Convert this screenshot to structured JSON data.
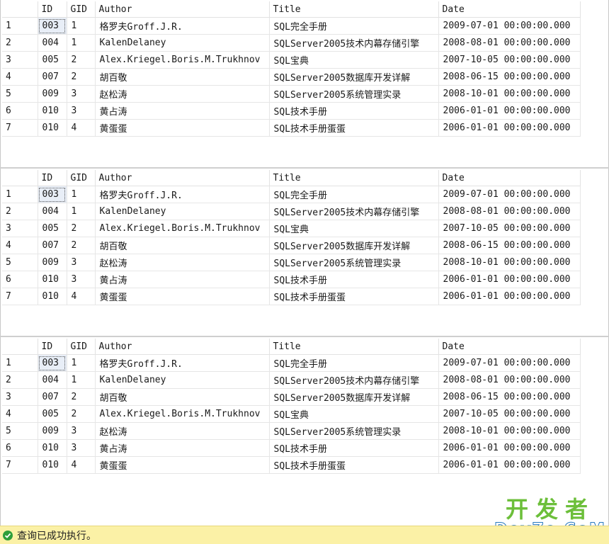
{
  "columns": [
    "",
    "ID",
    "GID",
    "Author",
    "Title",
    "Date"
  ],
  "grids": [
    {
      "rows": [
        [
          "1",
          "003",
          "1",
          "格罗夫Groff.J.R.",
          "SQL完全手册",
          "2009-07-01 00:00:00.000"
        ],
        [
          "2",
          "004",
          "1",
          "KalenDelaney",
          "SQLServer2005技术内幕存储引擎",
          "2008-08-01 00:00:00.000"
        ],
        [
          "3",
          "005",
          "2",
          "Alex.Kriegel.Boris.M.Trukhnov",
          "SQL宝典",
          "2007-10-05 00:00:00.000"
        ],
        [
          "4",
          "007",
          "2",
          "胡百敬",
          "SQLServer2005数据库开发详解",
          "2008-06-15 00:00:00.000"
        ],
        [
          "5",
          "009",
          "3",
          "赵松涛",
          "SQLServer2005系统管理实录",
          "2008-10-01 00:00:00.000"
        ],
        [
          "6",
          "010",
          "3",
          "黄占涛",
          "SQL技术手册",
          "2006-01-01 00:00:00.000"
        ],
        [
          "7",
          "010",
          "4",
          "黄蛋蛋",
          "SQL技术手册蛋蛋",
          "2006-01-01 00:00:00.000"
        ]
      ]
    },
    {
      "rows": [
        [
          "1",
          "003",
          "1",
          "格罗夫Groff.J.R.",
          "SQL完全手册",
          "2009-07-01 00:00:00.000"
        ],
        [
          "2",
          "004",
          "1",
          "KalenDelaney",
          "SQLServer2005技术内幕存储引擎",
          "2008-08-01 00:00:00.000"
        ],
        [
          "3",
          "005",
          "2",
          "Alex.Kriegel.Boris.M.Trukhnov",
          "SQL宝典",
          "2007-10-05 00:00:00.000"
        ],
        [
          "4",
          "007",
          "2",
          "胡百敬",
          "SQLServer2005数据库开发详解",
          "2008-06-15 00:00:00.000"
        ],
        [
          "5",
          "009",
          "3",
          "赵松涛",
          "SQLServer2005系统管理实录",
          "2008-10-01 00:00:00.000"
        ],
        [
          "6",
          "010",
          "3",
          "黄占涛",
          "SQL技术手册",
          "2006-01-01 00:00:00.000"
        ],
        [
          "7",
          "010",
          "4",
          "黄蛋蛋",
          "SQL技术手册蛋蛋",
          "2006-01-01 00:00:00.000"
        ]
      ]
    },
    {
      "rows": [
        [
          "1",
          "003",
          "1",
          "格罗夫Groff.J.R.",
          "SQL完全手册",
          "2009-07-01 00:00:00.000"
        ],
        [
          "2",
          "004",
          "1",
          "KalenDelaney",
          "SQLServer2005技术内幕存储引擎",
          "2008-08-01 00:00:00.000"
        ],
        [
          "3",
          "007",
          "2",
          "胡百敬",
          "SQLServer2005数据库开发详解",
          "2008-06-15 00:00:00.000"
        ],
        [
          "4",
          "005",
          "2",
          "Alex.Kriegel.Boris.M.Trukhnov",
          "SQL宝典",
          "2007-10-05 00:00:00.000"
        ],
        [
          "5",
          "009",
          "3",
          "赵松涛",
          "SQLServer2005系统管理实录",
          "2008-10-01 00:00:00.000"
        ],
        [
          "6",
          "010",
          "3",
          "黄占涛",
          "SQL技术手册",
          "2006-01-01 00:00:00.000"
        ],
        [
          "7",
          "010",
          "4",
          "黄蛋蛋",
          "SQL技术手册蛋蛋",
          "2006-01-01 00:00:00.000"
        ]
      ]
    }
  ],
  "status": {
    "message": "查询已成功执行。",
    "icon": "success-check-icon",
    "color": "#2f9e3a"
  },
  "watermark": {
    "line1": "开发者",
    "line2": "DevZe.CoM"
  }
}
